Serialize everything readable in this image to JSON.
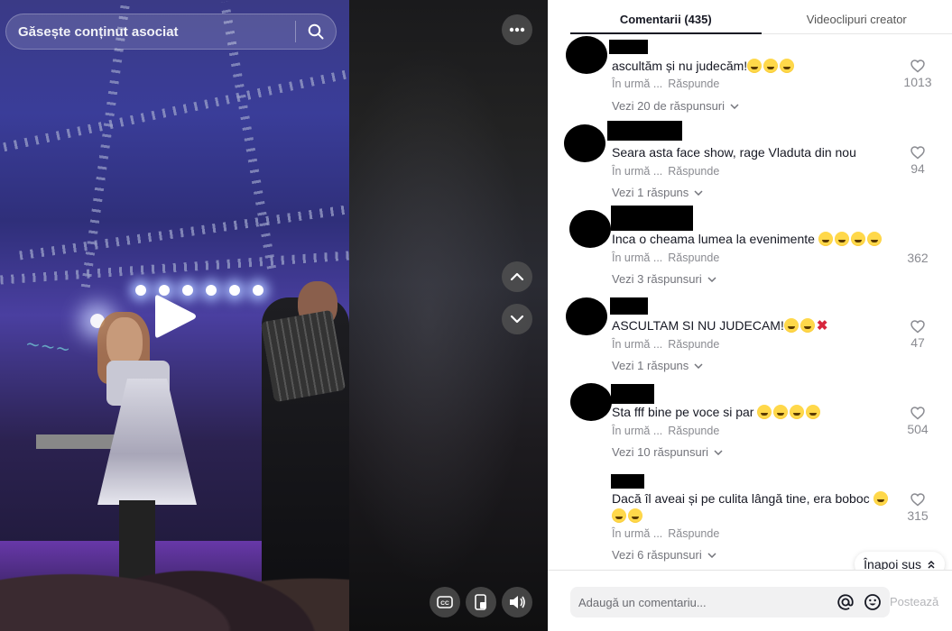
{
  "search": {
    "placeholder": "Găsește conținut asociat"
  },
  "tabs": [
    {
      "label": "Comentarii (435)",
      "active": true
    },
    {
      "label": "Videoclipuri creator",
      "active": false
    }
  ],
  "comments": [
    {
      "text": "ascultăm și nu judecăm!",
      "emojis": [
        "grin-sweat",
        "grin-sweat",
        "grin-sweat"
      ],
      "time": "În urmă ...",
      "reply": "Răspunde",
      "likes": "1013",
      "replies": "Vezi 20 de răspunsuri"
    },
    {
      "text": "Seara asta face show, rage Vladuta din nou",
      "emojis": [],
      "time": "În urmă ...",
      "reply": "Răspunde",
      "likes": "94",
      "replies": "Vezi 1 răspuns"
    },
    {
      "text": "Inca o cheama lumea la evenimente",
      "emojis": [
        "joy",
        "joy",
        "joy",
        "joy"
      ],
      "time": "În urmă ...",
      "reply": "Răspunde",
      "likes": "362",
      "replies": "Vezi 3 răspunsuri"
    },
    {
      "text": "ASCULTAM SI NU JUDECAM!",
      "emojis": [
        "grin-sweat",
        "grin-sweat",
        "cross-mark"
      ],
      "time": "În urmă ...",
      "reply": "Răspunde",
      "likes": "47",
      "replies": "Vezi 1 răspuns"
    },
    {
      "text": "Sta fff bine pe voce si par",
      "emojis": [
        "joy",
        "joy",
        "joy",
        "joy"
      ],
      "time": "În urmă ...",
      "reply": "Răspunde",
      "likes": "504",
      "replies": "Vezi 10 răspunsuri"
    },
    {
      "text": "Dacă îl aveai și pe culita lângă tine, era boboc",
      "emojis": [
        "rofl",
        "rofl",
        "rofl"
      ],
      "time": "În urmă ...",
      "reply": "Răspunde",
      "likes": "315",
      "replies": "Vezi 6 răspunsuri"
    }
  ],
  "back_to_top": "Înapoi sus",
  "compose": {
    "placeholder": "Adaugă un comentariu...",
    "post_label": "Postează"
  },
  "icons": {
    "search": "search-icon",
    "more": "more-icon",
    "up": "chevron-up-icon",
    "down": "chevron-down-icon",
    "cc": "captions-icon",
    "pip": "floating-player-icon",
    "volume": "volume-icon",
    "like": "heart-icon",
    "mention": "at-icon",
    "emoji": "emoji-icon",
    "play": "play-icon"
  },
  "colors": {
    "accent_text": "#161823",
    "muted_text": "#8a8b91",
    "overlay_button": "#545454"
  }
}
